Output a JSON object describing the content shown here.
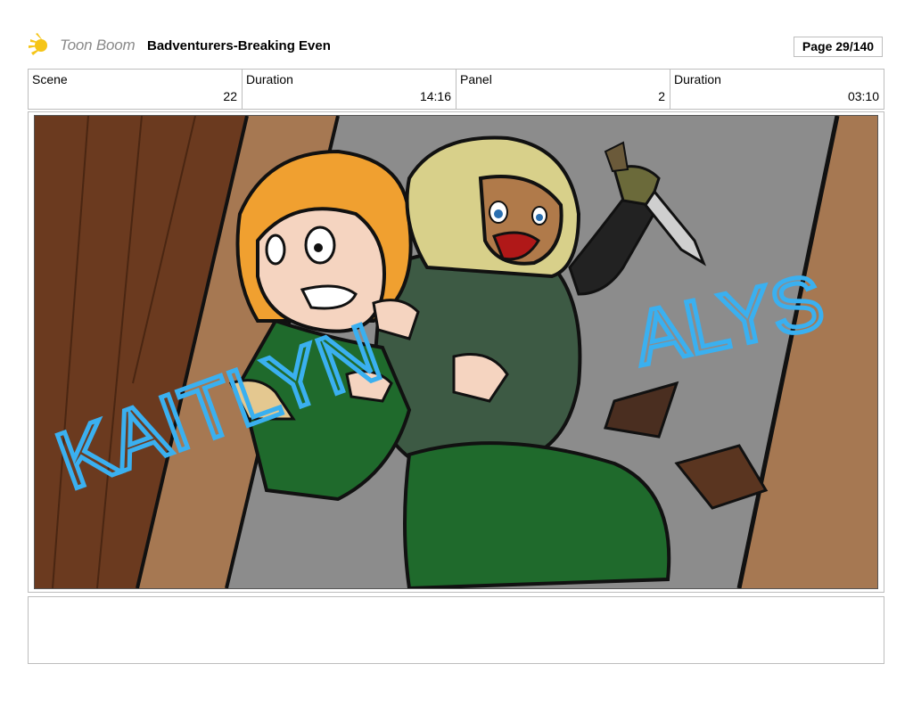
{
  "header": {
    "logo_text": "Toon Boom",
    "project_title": "Badventurers-Breaking Even",
    "page_label": "Page  29/140"
  },
  "info": {
    "scene_label": "Scene",
    "scene_value": "22",
    "scene_duration_label": "Duration",
    "scene_duration_value": "14:16",
    "panel_label": "Panel",
    "panel_value": "2",
    "panel_duration_label": "Duration",
    "panel_duration_value": "03:10"
  },
  "panel": {
    "annotation_left": "KAITLYN",
    "annotation_right": "ALYS"
  },
  "notes": {
    "text": ""
  },
  "colors": {
    "annotation_blue": "#3ab0f0",
    "wall_dark": "#6b3a1f",
    "wall_light": "#a67852",
    "floor_gray": "#8c8c8c",
    "tunic_green": "#1f6a2c",
    "cloak_green": "#3d5a44",
    "hair_orange": "#f0a030",
    "hair_blonde": "#d8d08a"
  }
}
